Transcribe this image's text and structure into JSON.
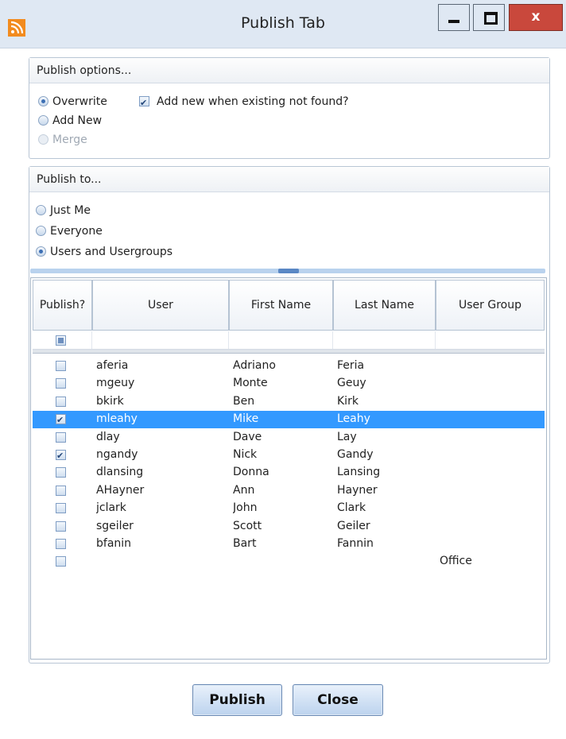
{
  "window": {
    "title": "Publish Tab",
    "close_glyph": "x"
  },
  "publish_options": {
    "heading": "Publish options...",
    "modes": [
      {
        "label": "Overwrite",
        "selected": true,
        "enabled": true
      },
      {
        "label": "Add New",
        "selected": false,
        "enabled": true
      },
      {
        "label": "Merge",
        "selected": false,
        "enabled": false
      }
    ],
    "add_new_when_missing": {
      "label": "Add new when existing not found?",
      "checked": true
    }
  },
  "publish_to": {
    "heading": "Publish to...",
    "targets": [
      {
        "label": "Just Me",
        "selected": false
      },
      {
        "label": "Everyone",
        "selected": false
      },
      {
        "label": "Users and Usergroups",
        "selected": true
      }
    ]
  },
  "grid": {
    "columns": [
      "Publish?",
      "User",
      "First Name",
      "Last Name",
      "User Group"
    ],
    "rows": [
      {
        "publish": false,
        "user": "aferia",
        "first": "Adriano",
        "last": "Feria",
        "group": ""
      },
      {
        "publish": false,
        "user": "mgeuy",
        "first": "Monte",
        "last": "Geuy",
        "group": ""
      },
      {
        "publish": false,
        "user": "bkirk",
        "first": "Ben",
        "last": "Kirk",
        "group": ""
      },
      {
        "publish": true,
        "user": "mleahy",
        "first": "Mike",
        "last": "Leahy",
        "group": "",
        "selected": true
      },
      {
        "publish": false,
        "user": "dlay",
        "first": "Dave",
        "last": "Lay",
        "group": ""
      },
      {
        "publish": true,
        "user": "ngandy",
        "first": "Nick",
        "last": "Gandy",
        "group": ""
      },
      {
        "publish": false,
        "user": "dlansing",
        "first": "Donna",
        "last": "Lansing",
        "group": ""
      },
      {
        "publish": false,
        "user": "AHayner",
        "first": "Ann",
        "last": "Hayner",
        "group": ""
      },
      {
        "publish": false,
        "user": "jclark",
        "first": "John",
        "last": "Clark",
        "group": ""
      },
      {
        "publish": false,
        "user": "sgeiler",
        "first": "Scott",
        "last": "Geiler",
        "group": ""
      },
      {
        "publish": false,
        "user": "bfanin",
        "first": "Bart",
        "last": "Fannin",
        "group": ""
      },
      {
        "publish": false,
        "user": "",
        "first": "",
        "last": "",
        "group": "Office"
      }
    ]
  },
  "actions": {
    "publish_label": "Publish",
    "close_label": "Close"
  },
  "colors": {
    "selection": "#3399ff",
    "titlebar": "#dfe8f3",
    "close_button": "#c9483c"
  },
  "icons": {
    "app": "rss-feed-icon",
    "minimize": "minimize-icon",
    "maximize": "maximize-icon",
    "close": "close-icon"
  }
}
